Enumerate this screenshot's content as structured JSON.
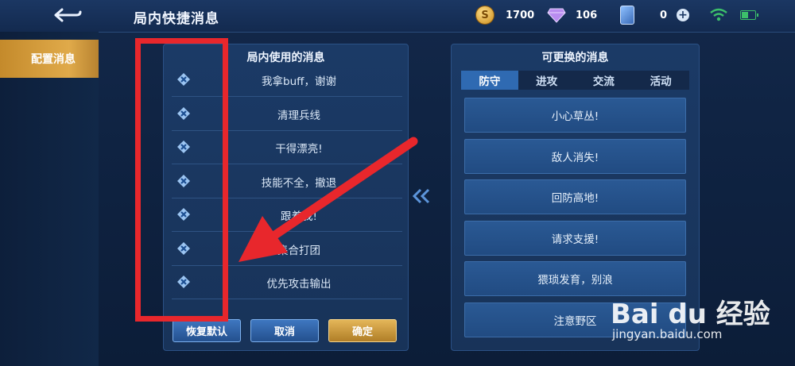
{
  "header": {
    "title": "局内快捷消息"
  },
  "resources": {
    "gold": "1700",
    "diamonds": "106",
    "tickets": "0",
    "coin_glyph": "S"
  },
  "sidebar": {
    "items": [
      {
        "label": "配置消息"
      }
    ]
  },
  "left_panel": {
    "title": "局内使用的消息",
    "messages": [
      "我拿buff，谢谢",
      "清理兵线",
      "干得漂亮!",
      "技能不全，撤退",
      "跟着我!",
      "集合打团",
      "优先攻击输出"
    ],
    "buttons": {
      "reset": "恢复默认",
      "cancel": "取消",
      "confirm": "确定"
    }
  },
  "right_panel": {
    "title": "可更换的消息",
    "tabs": [
      "防守",
      "进攻",
      "交流",
      "活动"
    ],
    "active_tab": "防守",
    "options": [
      "小心草丛!",
      "敌人消失!",
      "回防高地!",
      "请求支援!",
      "猥琐发育，别浪",
      "注意野区"
    ]
  },
  "watermark": {
    "main": "Bai du 经验",
    "sub": "jingyan.baidu.com"
  },
  "colors": {
    "accent_gold": "#e0aa4a",
    "annotation_red": "#e8272c",
    "tab_active": "#2f6ab2"
  }
}
